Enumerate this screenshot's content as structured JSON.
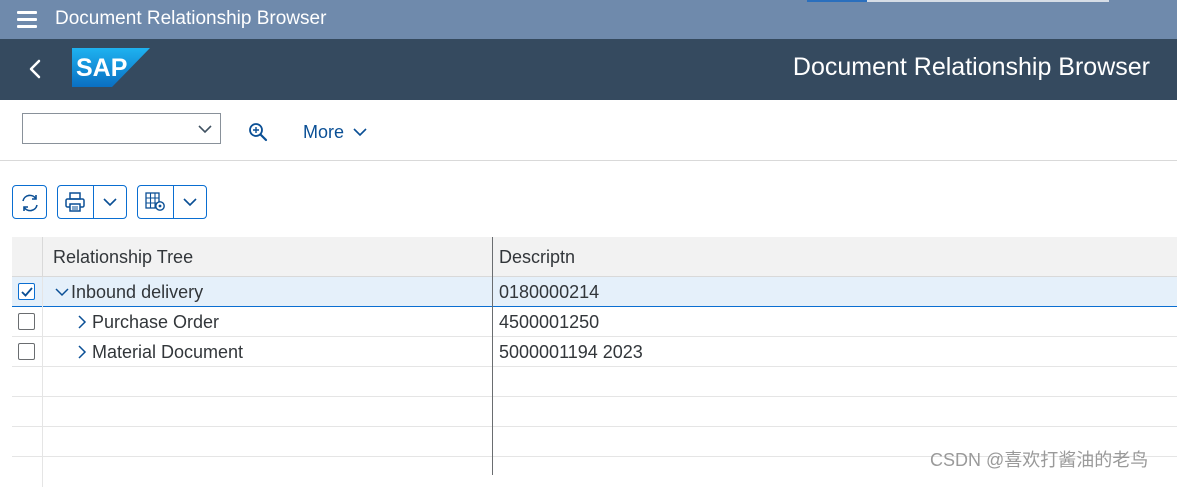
{
  "window": {
    "title": "Document Relationship Browser"
  },
  "shell": {
    "title": "Document Relationship Browser",
    "logo_text": "SAP"
  },
  "toolbar": {
    "dropdown_value": "",
    "more_label": "More"
  },
  "table": {
    "columns": [
      "Relationship Tree",
      "Descriptn"
    ],
    "rows": [
      {
        "label": "Inbound delivery",
        "description": "0180000214",
        "expanded": true,
        "checked": true,
        "level": 0
      },
      {
        "label": "Purchase Order",
        "description": "4500001250",
        "expanded": false,
        "checked": false,
        "level": 1
      },
      {
        "label": "Material Document",
        "description": "5000001194 2023",
        "expanded": false,
        "checked": false,
        "level": 1
      }
    ]
  },
  "icons": {
    "menu": "hamburger-icon",
    "back": "back-icon",
    "search": "zoom-icon",
    "refresh": "refresh-icon",
    "print": "print-icon",
    "settings": "table-settings-icon"
  },
  "colors": {
    "title_bar": "#6f8aac",
    "shell_bar": "#354a5f",
    "accent": "#0a6ed1"
  },
  "watermark": "CSDN @喜欢打酱油的老鸟"
}
